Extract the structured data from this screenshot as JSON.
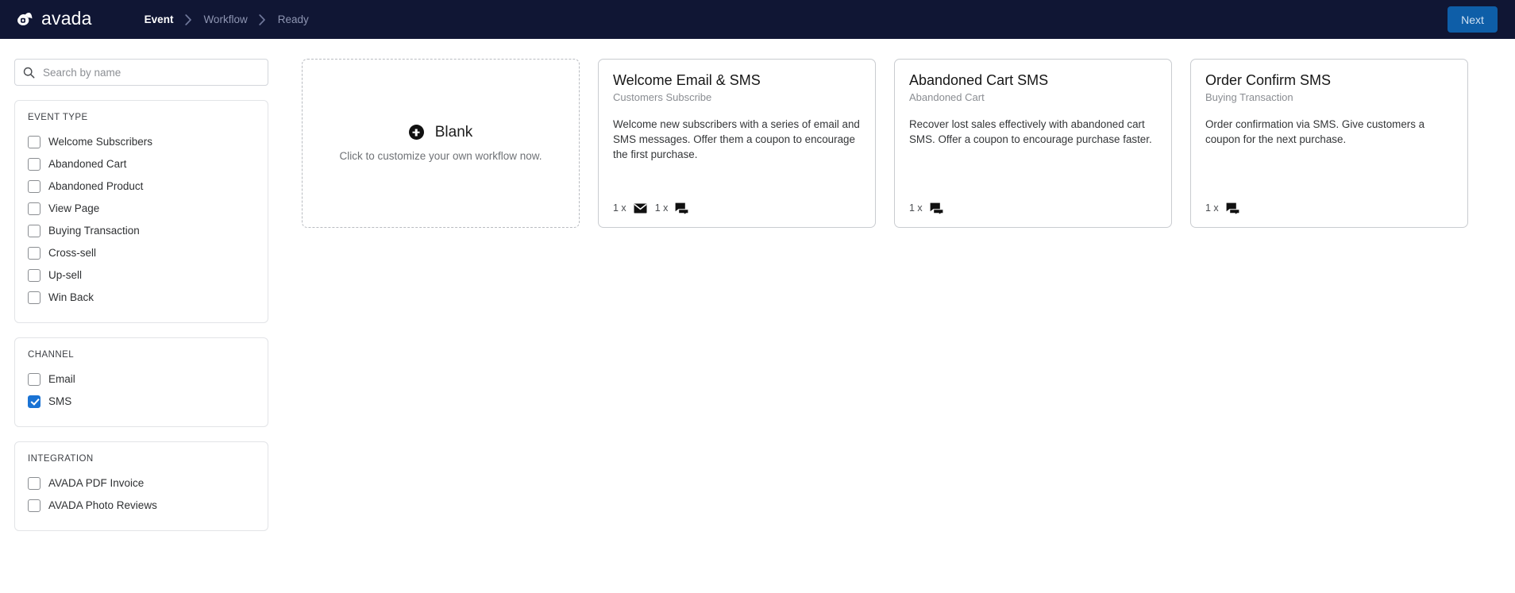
{
  "header": {
    "brand": "avada",
    "brand_icon": "avada-cloud-logo",
    "breadcrumbs": [
      {
        "label": "Event",
        "active": true
      },
      {
        "label": "Workflow",
        "active": false
      },
      {
        "label": "Ready",
        "active": false
      }
    ],
    "next_label": "Next",
    "colors": {
      "bar": "#101634",
      "next_button": "#0e5ea8",
      "accent": "#1a73d4"
    }
  },
  "sidebar": {
    "search": {
      "placeholder": "Search by name",
      "value": "",
      "icon": "search-icon"
    },
    "panels": [
      {
        "title": "EVENT TYPE",
        "options": [
          {
            "label": "Welcome Subscribers",
            "checked": false
          },
          {
            "label": "Abandoned Cart",
            "checked": false
          },
          {
            "label": "Abandoned Product",
            "checked": false
          },
          {
            "label": "View Page",
            "checked": false
          },
          {
            "label": "Buying Transaction",
            "checked": false
          },
          {
            "label": "Cross-sell",
            "checked": false
          },
          {
            "label": "Up-sell",
            "checked": false
          },
          {
            "label": "Win Back",
            "checked": false
          }
        ]
      },
      {
        "title": "CHANNEL",
        "options": [
          {
            "label": "Email",
            "checked": false
          },
          {
            "label": "SMS",
            "checked": true
          }
        ]
      },
      {
        "title": "INTEGRATION",
        "options": [
          {
            "label": "AVADA PDF Invoice",
            "checked": false
          },
          {
            "label": "AVADA Photo Reviews",
            "checked": false
          }
        ]
      }
    ]
  },
  "main": {
    "blank_card": {
      "title": "Blank",
      "subtitle": "Click to customize your own workflow now.",
      "icon": "plus-circle-icon"
    },
    "cards": [
      {
        "title": "Welcome Email & SMS",
        "subtitle": "Customers Subscribe",
        "description": "Welcome new subscribers with a series of email and SMS messages. Offer them a coupon to encourage the first purchase.",
        "steps": [
          {
            "count": "1 x",
            "icon": "email-icon"
          },
          {
            "count": "1 x",
            "icon": "sms-forum-icon"
          }
        ]
      },
      {
        "title": "Abandoned Cart SMS",
        "subtitle": "Abandoned Cart",
        "description": "Recover lost sales effectively with abandoned cart SMS. Offer a coupon to encourage purchase faster.",
        "steps": [
          {
            "count": "1 x",
            "icon": "sms-forum-icon"
          }
        ]
      },
      {
        "title": "Order Confirm SMS",
        "subtitle": "Buying Transaction",
        "description": "Order confirmation via SMS. Give customers a coupon for the next purchase.",
        "steps": [
          {
            "count": "1 x",
            "icon": "sms-forum-icon"
          }
        ]
      }
    ]
  }
}
